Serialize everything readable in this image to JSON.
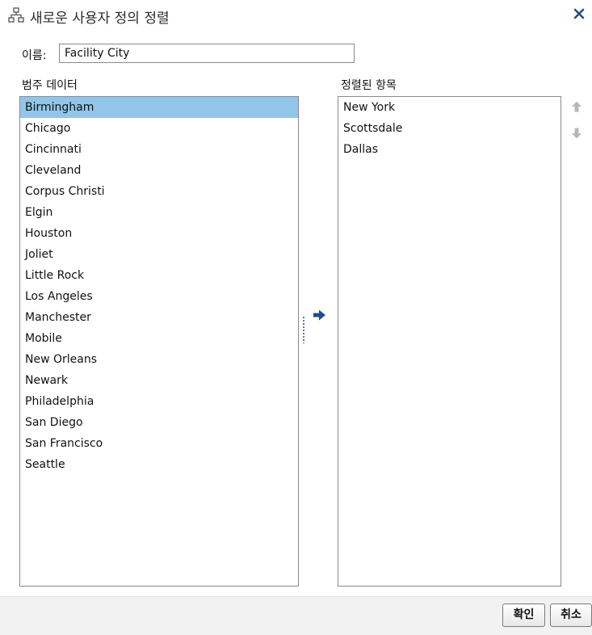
{
  "dialog": {
    "title": "새로운 사용자 정의 정렬",
    "title_icon": "hierarchy-icon",
    "close_icon": "close-icon"
  },
  "name_field": {
    "label": "이름:",
    "value": "Facility City"
  },
  "category_list": {
    "label": "범주 데이터",
    "items": [
      "Birmingham",
      "Chicago",
      "Cincinnati",
      "Cleveland",
      "Corpus Christi",
      "Elgin",
      "Houston",
      "Joliet",
      "Little Rock",
      "Los Angeles",
      "Manchester",
      "Mobile",
      "New Orleans",
      "Newark",
      "Philadelphia",
      "San Diego",
      "San Francisco",
      "Seattle"
    ],
    "selected": "Birmingham"
  },
  "sorted_list": {
    "label": "정렬된 항목",
    "items": [
      "New York",
      "Scottsdale",
      "Dallas"
    ]
  },
  "controls": {
    "move_right_icon": "arrow-right-icon",
    "move_up_icon": "arrow-up-icon",
    "move_down_icon": "arrow-down-icon",
    "splitter_icon": "grip-dots-icon"
  },
  "footer": {
    "ok_label": "확인",
    "cancel_label": "취소"
  },
  "colors": {
    "selection": "#92c5e9",
    "accent_arrow": "#1f4f86",
    "disabled_arrow": "#b8b8b8",
    "close": "#2a4f7a"
  }
}
